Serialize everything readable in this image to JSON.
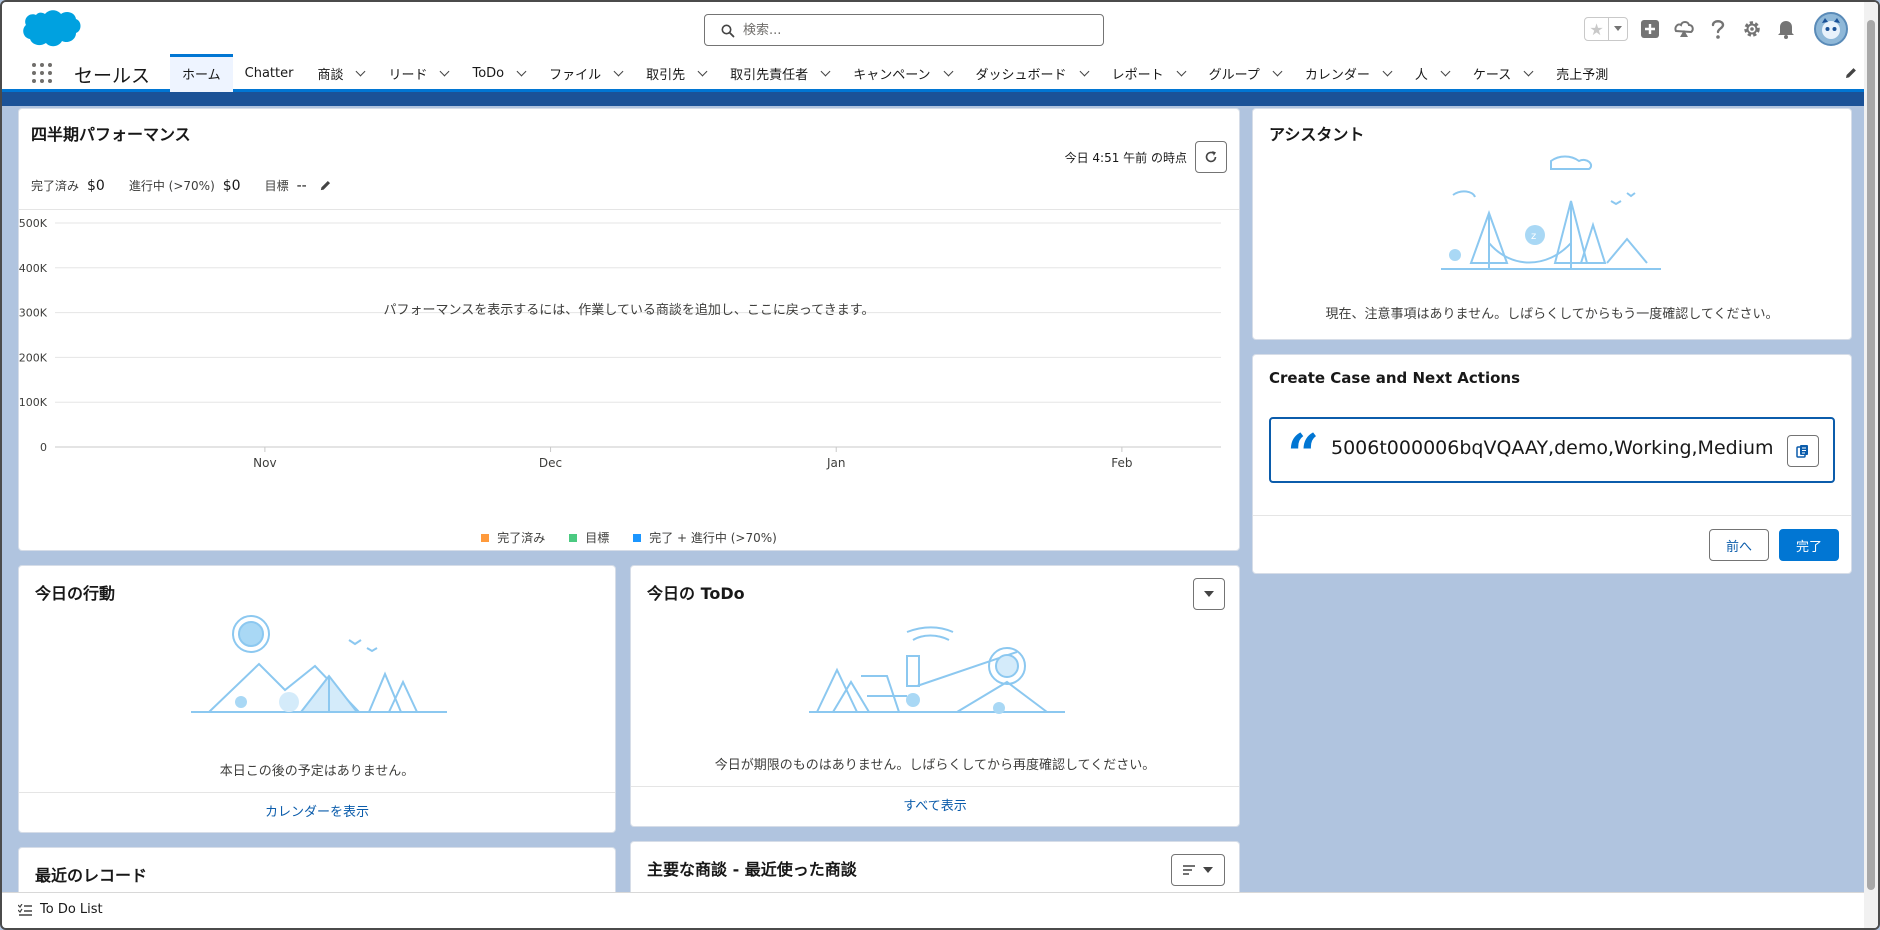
{
  "header": {
    "search_placeholder": "検索...",
    "icons": [
      "salesforce-cloud-logo",
      "star-icon",
      "add-icon",
      "trailhead-icon",
      "help-icon",
      "setup-gear-icon",
      "bell-icon",
      "user-avatar"
    ]
  },
  "nav": {
    "app_name": "セールス",
    "tabs": [
      {
        "label": "ホーム",
        "active": true,
        "chevron": false
      },
      {
        "label": "Chatter",
        "chevron": false
      },
      {
        "label": "商談",
        "chevron": true
      },
      {
        "label": "リード",
        "chevron": true
      },
      {
        "label": "ToDo",
        "chevron": true
      },
      {
        "label": "ファイル",
        "chevron": true
      },
      {
        "label": "取引先",
        "chevron": true
      },
      {
        "label": "取引先責任者",
        "chevron": true
      },
      {
        "label": "キャンペーン",
        "chevron": true
      },
      {
        "label": "ダッシュボード",
        "chevron": true
      },
      {
        "label": "レポート",
        "chevron": true
      },
      {
        "label": "グループ",
        "chevron": true
      },
      {
        "label": "カレンダー",
        "chevron": true
      },
      {
        "label": "人",
        "chevron": true
      },
      {
        "label": "ケース",
        "chevron": true
      },
      {
        "label": "売上予測",
        "chevron": false
      }
    ]
  },
  "performance": {
    "title": "四半期パフォーマンス",
    "as_of": "今日 4:51 午前 の時点",
    "closed_label": "完了済み",
    "closed_value": "$0",
    "open_label": "進行中 (>70%)",
    "open_value": "$0",
    "goal_label": "目標",
    "goal_value": "--",
    "empty_message": "パフォーマンスを表示するには、作業している商談を追加し、ここに戻ってきます。"
  },
  "chart_data": {
    "type": "line",
    "y_ticks": [
      "500K",
      "400K",
      "300K",
      "200K",
      "100K",
      "0"
    ],
    "y_values": [
      500000,
      400000,
      300000,
      200000,
      100000,
      0
    ],
    "ylim": [
      0,
      500000
    ],
    "x_ticks": [
      "Nov",
      "Dec",
      "Jan",
      "Feb"
    ],
    "series": [
      {
        "name": "完了済み",
        "color": "#ff9a3c",
        "values": []
      },
      {
        "name": "目標",
        "color": "#4bca81",
        "values": []
      },
      {
        "name": "完了 + 進行中 (>70%)",
        "color": "#1b96ff",
        "values": []
      }
    ],
    "grid": true,
    "legend": "bottom"
  },
  "events": {
    "title": "今日の行動",
    "empty_message": "本日この後の予定はありません。",
    "footer_link": "カレンダーを表示"
  },
  "todo": {
    "title": "今日の ToDo",
    "empty_message": "今日が期限のものはありません。しばらくしてから再度確認してください。",
    "footer_link": "すべて表示"
  },
  "recent": {
    "title": "最近のレコード"
  },
  "opportunities": {
    "title": "主要な商談 - 最近使った商談"
  },
  "assistant": {
    "title": "アシスタント",
    "empty_message": "現在、注意事項はありません。しばらくしてからもう一度確認してください。"
  },
  "create_case": {
    "title": "Create Case and Next Actions",
    "quote_text": "5006t000006bqVQAAY,demo,Working,Medium",
    "prev_button": "前へ",
    "done_button": "完了"
  },
  "utility_bar": {
    "todo_list": "To Do List"
  },
  "colors": {
    "brand": "#0176d3",
    "link": "#0b5cab",
    "background": "#b0c4df",
    "stripe": "#1b5297",
    "illustration": "#8cc8f0"
  }
}
